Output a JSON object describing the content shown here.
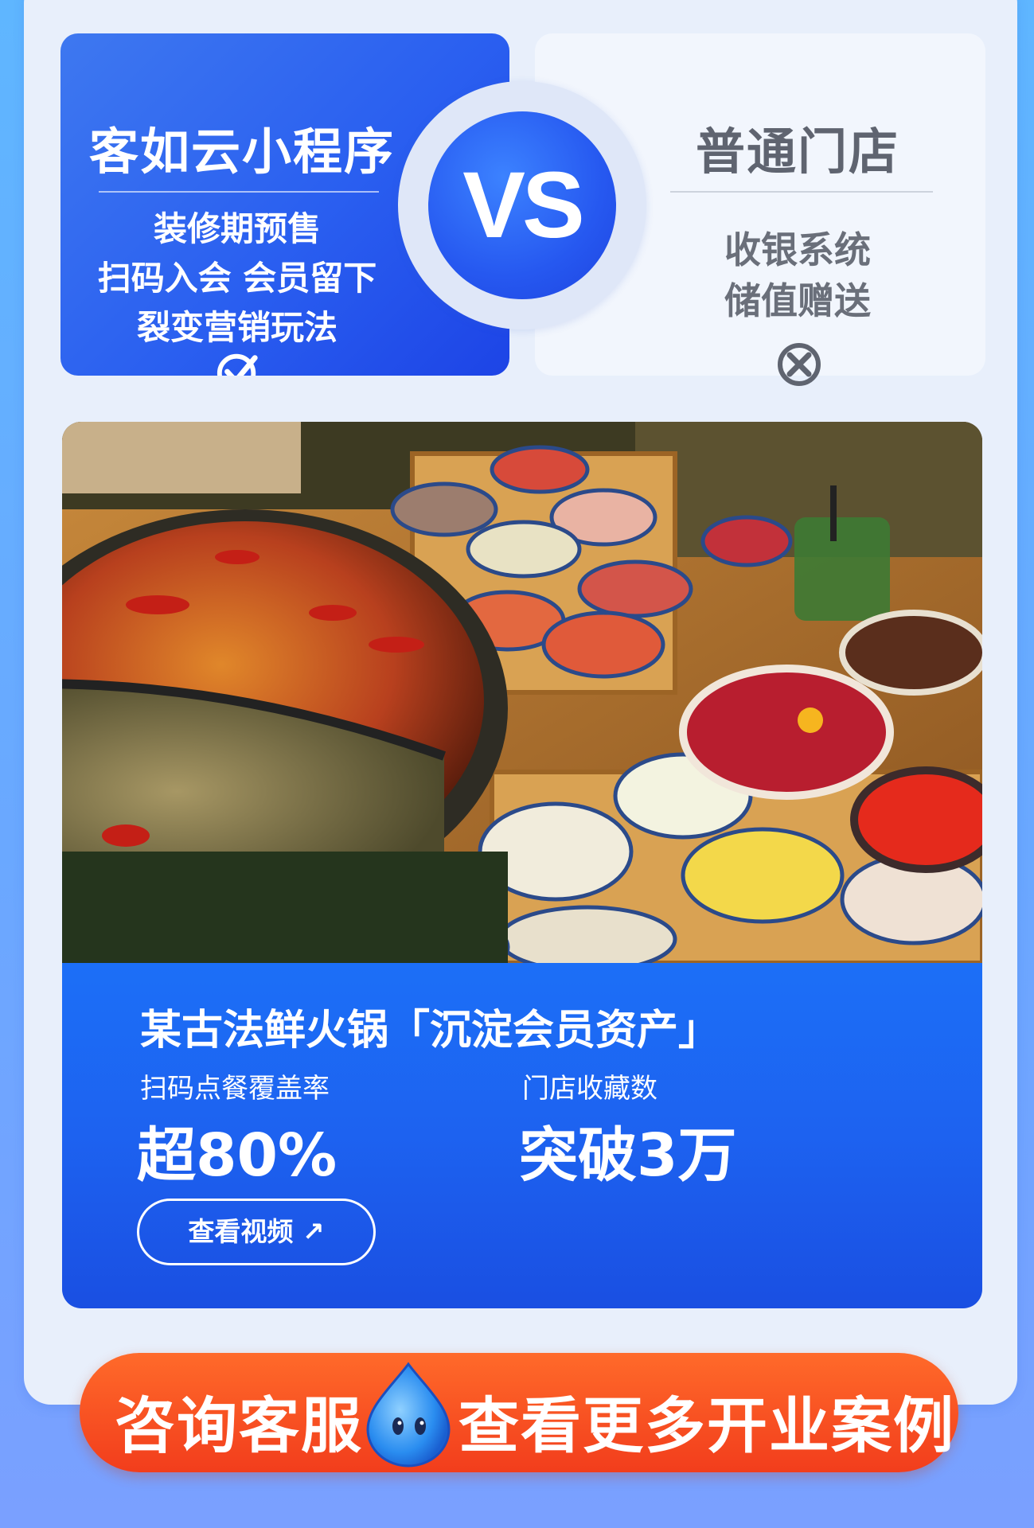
{
  "compare": {
    "left": {
      "title": "客如云小程序",
      "lines": [
        "装修期预售",
        "扫码入会 会员留下",
        "裂变营销玩法"
      ],
      "icon": "check-circle-icon"
    },
    "vs_label": "VS",
    "right": {
      "title": "普通门店",
      "lines": [
        "收银系统",
        "储值赠送"
      ],
      "icon": "x-circle-icon"
    }
  },
  "case": {
    "photo_alt": "hotpot-photo",
    "title": "某古法鲜火锅「沉淀会员资产」",
    "stats": [
      {
        "label": "扫码点餐覆盖率",
        "value": "超80%"
      },
      {
        "label": "门店收藏数",
        "value": "突破3万"
      }
    ],
    "video_button": "查看视频 ↗"
  },
  "cta": {
    "left": "咨询客服",
    "right": "查看更多开业案例",
    "mascot_icon": "water-drop-mascot-icon"
  },
  "colors": {
    "accent_blue": "#1d62f0",
    "cta_red": "#f23d1c",
    "background": "#e8effb"
  }
}
